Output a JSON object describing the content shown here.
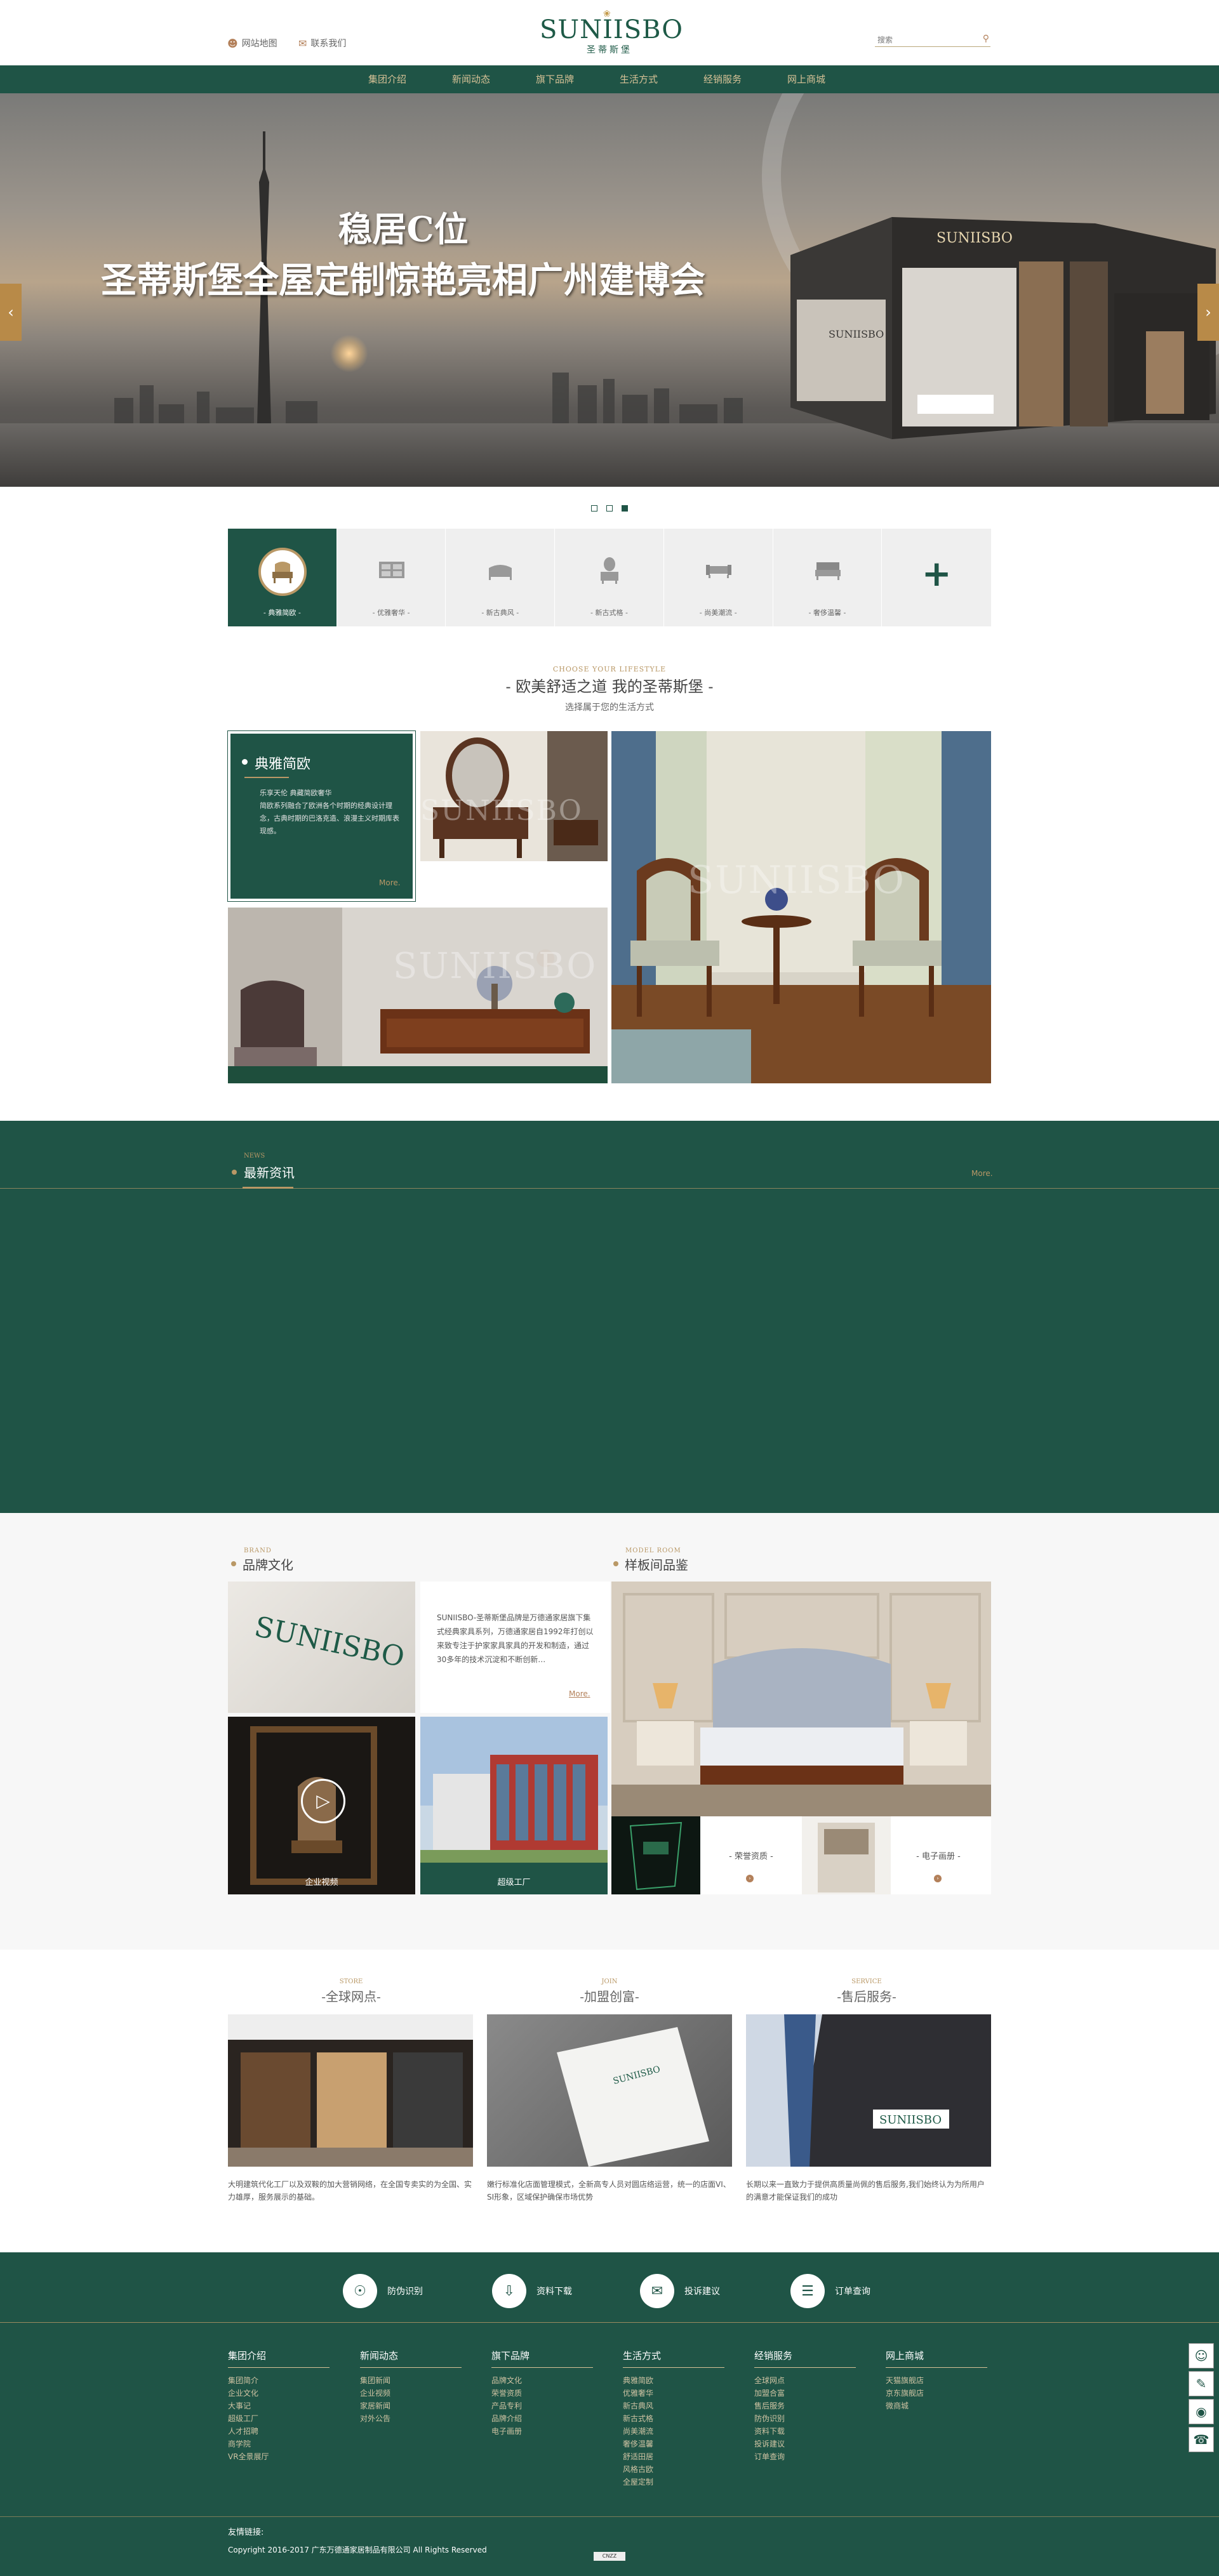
{
  "header": {
    "links": [
      {
        "icon": "user-icon",
        "label": "网站地图"
      },
      {
        "icon": "mail-icon",
        "label": "联系我们"
      }
    ],
    "logo": {
      "text": "SUNIISBO",
      "sub": "圣蒂斯堡"
    },
    "search": {
      "placeholder": "搜索"
    }
  },
  "nav": {
    "items": [
      "集团介绍",
      "新闻动态",
      "旗下品牌",
      "生活方式",
      "经销服务",
      "网上商城"
    ]
  },
  "banner": {
    "line1": "稳居C位",
    "line2": "圣蒂斯堡全屋定制惊艳亮相广州建博会",
    "store_sign": "SUNIISBO",
    "active_slide": 3,
    "slide_count": 3
  },
  "categories": [
    {
      "label": "- 典雅简欧 -",
      "icon": "armchair-icon",
      "active": true
    },
    {
      "label": "- 优雅奢华 -",
      "icon": "cabinet-icon"
    },
    {
      "label": "- 新古典风 -",
      "icon": "sofa-icon"
    },
    {
      "label": "- 新古式格 -",
      "icon": "vanity-icon"
    },
    {
      "label": "- 尚美潮流 -",
      "icon": "couch-icon"
    },
    {
      "label": "- 奢侈温馨 -",
      "icon": "bed-icon"
    },
    {
      "label": "",
      "icon": "plus-icon"
    }
  ],
  "lifestyle": {
    "en": "CHOOSE YOUR LIFESTYLE",
    "title": "- 欧美舒适之道  我的圣蒂斯堡 -",
    "sub": "选择属于您的生活方式",
    "card": {
      "title": "典雅简欧",
      "text": "乐享天伦 典藏简欧奢华\n简欧系列融合了欧洲各个时期的经典设计理念，古典时期的巴洛克造、浪漫主义时期库表现感。",
      "more": "More."
    },
    "watermark": "SUNIISBO"
  },
  "news": {
    "en": "NEWS",
    "title": "最新资讯",
    "more": "More."
  },
  "brand": {
    "en": "BRAND",
    "title": "品牌文化",
    "text": "SUNIISBO-圣蒂斯堡品牌是万德通家居旗下集式经典家具系列，万德通家居自1992年打创以来致专注于护家家具家具的开发和制造，通过30多年的技术沉淀和不断创新…",
    "more": "More.",
    "video": "企业视频",
    "factory": "超级工厂"
  },
  "showroom": {
    "en": "MODEL ROOM",
    "title": "样板间品鉴",
    "honor": "- 荣誉资质 -",
    "album": "- 电子画册 -"
  },
  "services": [
    {
      "en": "STORE",
      "title": "-全球网点-",
      "text": "大明建筑代化工厂以及双鞍的加大营销网络，在全国专卖实的为全国、实力雄厚，服务展示的基础。"
    },
    {
      "en": "JOIN",
      "title": "-加盟创富-",
      "text": "嫩行标准化店面管理模式，全新高专人员对圆店络运营，统一的店面VI、SI形象，区域保护确保市场优势"
    },
    {
      "en": "SERVICE",
      "title": "-售后服务-",
      "text": "长期以来一直致力于提供高质量尚佩的售后服务,我们始终认为为所用户的满意才能保证我们的成功"
    }
  ],
  "quick": [
    {
      "icon": "shield-icon",
      "label": "防伪识别"
    },
    {
      "icon": "download-icon",
      "label": "资料下载"
    },
    {
      "icon": "chat-icon",
      "label": "投诉建议"
    },
    {
      "icon": "order-icon",
      "label": "订单查询"
    }
  ],
  "footer_cols": [
    {
      "title": "集团介绍",
      "items": [
        "集团简介",
        "企业文化",
        "大事记",
        "超级工厂",
        "人才招聘",
        "商学院",
        "VR全景展厅"
      ]
    },
    {
      "title": "新闻动态",
      "items": [
        "集团新闻",
        "企业视频",
        "家居新闻",
        "对外公告"
      ]
    },
    {
      "title": "旗下品牌",
      "items": [
        "品牌文化",
        "荣誉资质",
        "产品专利",
        "品牌介绍",
        "电子画册"
      ]
    },
    {
      "title": "生活方式",
      "items": [
        "典雅简欧",
        "优雅奢华",
        "新古典风",
        "新古式格",
        "尚美潮流",
        "奢侈温馨",
        "舒适田居",
        "风格古欧",
        "全屋定制"
      ]
    },
    {
      "title": "经销服务",
      "items": [
        "全球网点",
        "加盟合富",
        "售后服务",
        "防伪识别",
        "资料下载",
        "投诉建议",
        "订单查询"
      ]
    },
    {
      "title": "网上商城",
      "items": [
        "天猫旗舰店",
        "京东旗舰店",
        "微商城"
      ]
    }
  ],
  "footer": {
    "friend_links": "友情链接:",
    "copyright": "Copyright  2016-2017  广东万德通家居制品有限公司  All Rights Reserved"
  },
  "side_icons": [
    "qq-icon",
    "wechat-icon",
    "weibo-icon",
    "phone-icon"
  ]
}
